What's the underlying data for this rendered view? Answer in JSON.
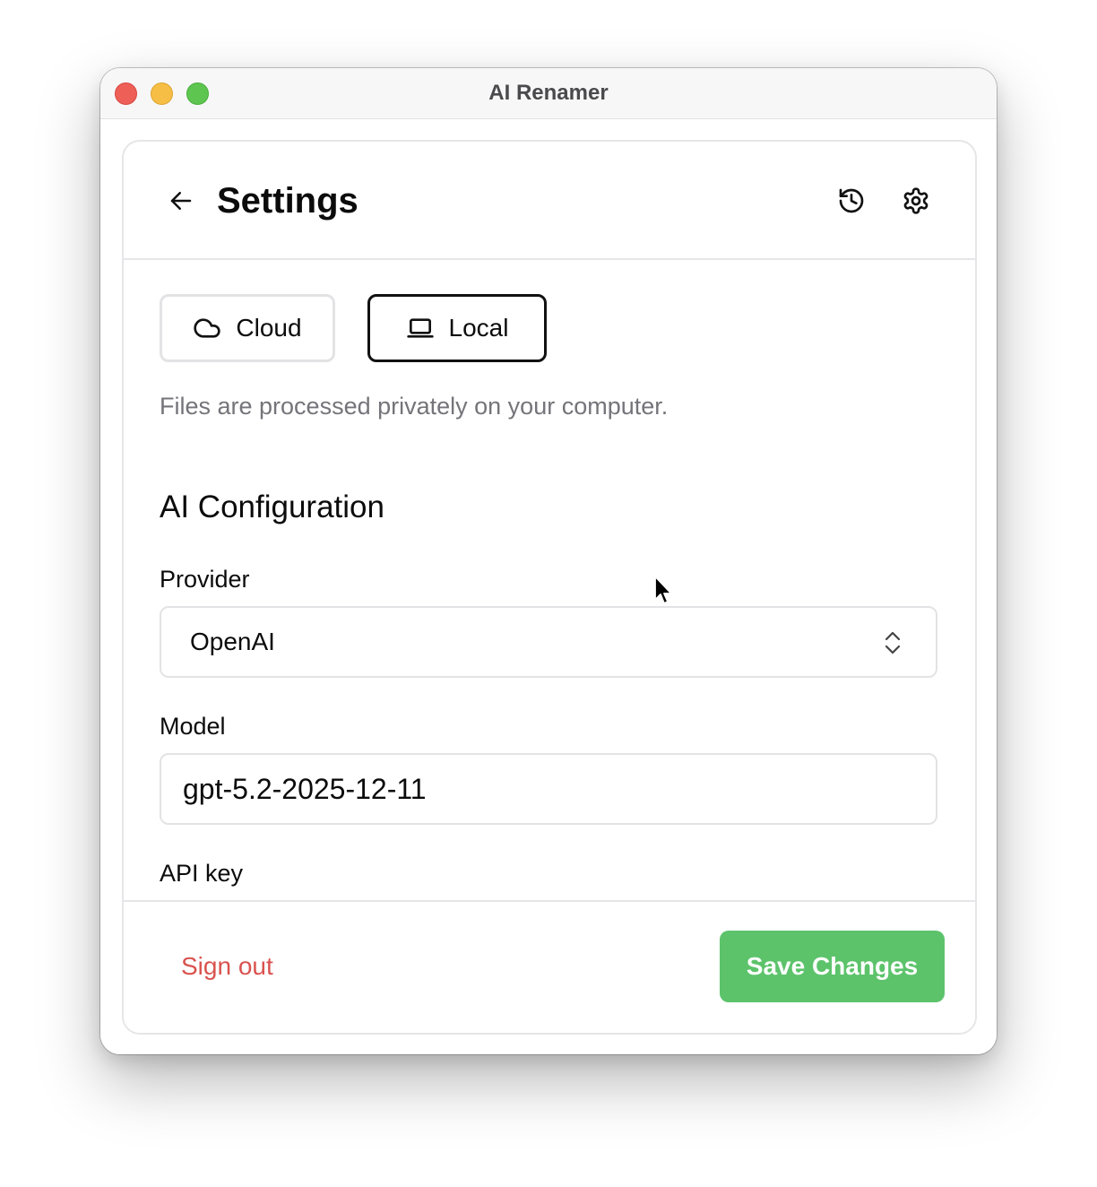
{
  "window": {
    "title": "AI Renamer"
  },
  "header": {
    "title": "Settings",
    "icons": {
      "back": "arrow-left-icon",
      "history": "history-icon",
      "settings": "gear-icon"
    }
  },
  "mode": {
    "options": [
      {
        "label": "Cloud",
        "icon": "cloud-icon",
        "selected": false
      },
      {
        "label": "Local",
        "icon": "laptop-icon",
        "selected": true
      }
    ],
    "description": "Files are processed privately on your computer."
  },
  "ai_config": {
    "title": "AI Configuration",
    "provider": {
      "label": "Provider",
      "value": "OpenAI"
    },
    "model": {
      "label": "Model",
      "value": "gpt-5.2-2025-12-11"
    },
    "api_key": {
      "label": "API key"
    }
  },
  "footer": {
    "sign_out_label": "Sign out",
    "save_label": "Save Changes"
  },
  "colors": {
    "save_button": "#5cc36b",
    "sign_out": "#d9534f",
    "selected_border": "#111111",
    "unselected_border": "#e3e3e5"
  }
}
